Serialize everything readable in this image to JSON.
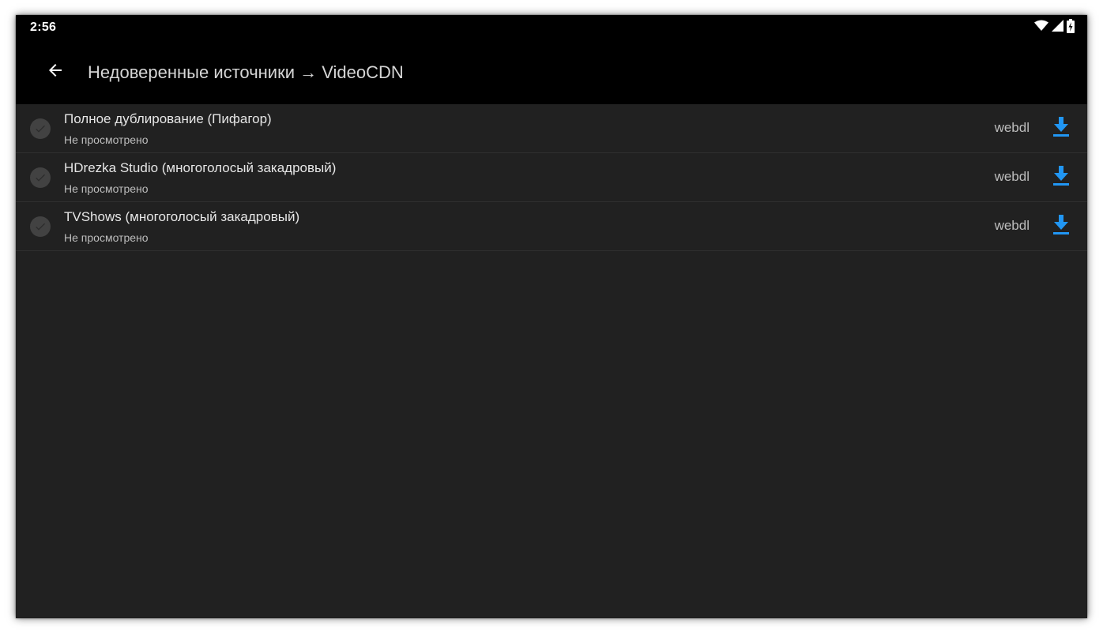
{
  "status_bar": {
    "time": "2:56",
    "icons": [
      "wifi-icon",
      "signal-icon",
      "battery-charging-icon"
    ]
  },
  "app_bar": {
    "back_icon": "arrow-back-icon",
    "title": "Недоверенные источники → VideoCDN"
  },
  "sources": [
    {
      "title": "Полное дублирование (Пифагор)",
      "status": "Не просмотрено",
      "quality": "webdl",
      "action_icon": "download-icon"
    },
    {
      "title": "HDrezka Studio (многоголосый закадровый)",
      "status": "Не просмотрено",
      "quality": "webdl",
      "action_icon": "download-icon"
    },
    {
      "title": "TVShows (многоголосый закадровый)",
      "status": "Не просмотрено",
      "quality": "webdl",
      "action_icon": "download-icon"
    }
  ],
  "colors": {
    "background": "#212121",
    "bar": "#000000",
    "accent": "#2196f3",
    "check_bg": "#424242"
  }
}
